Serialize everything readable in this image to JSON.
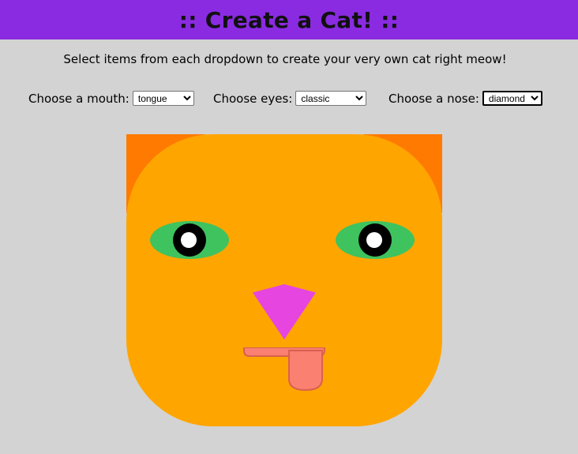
{
  "header": {
    "title": ":: Create a Cat! ::"
  },
  "subtitle": "Select items from each dropdown to create your very own cat right meow!",
  "controls": {
    "mouth": {
      "label": "Choose a mouth:",
      "value": "tongue"
    },
    "eyes": {
      "label": "Choose eyes:",
      "value": "classic"
    },
    "nose": {
      "label": "Choose a nose:",
      "value": "diamond"
    }
  },
  "colors": {
    "header_bg": "#8a2be2",
    "page_bg": "#d3d3d3",
    "head": "#ffa500",
    "ears": "#ff7a00",
    "eyes": "#3ec35f",
    "nose": "#e645e0",
    "tongue": "#fa8072"
  }
}
